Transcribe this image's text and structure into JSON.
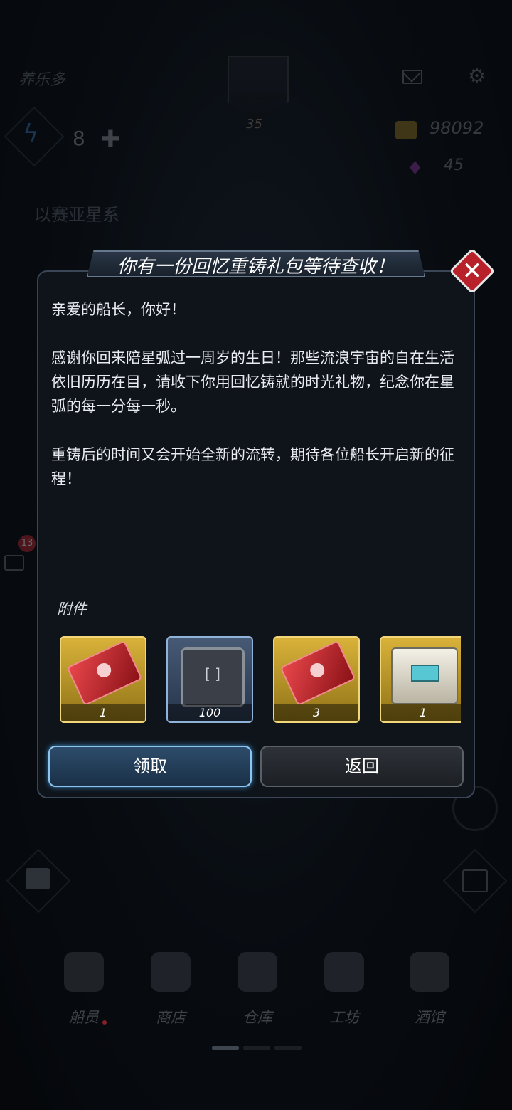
{
  "hud": {
    "player_name": "养乐多",
    "level": "35",
    "energy": "8",
    "gold": "98092",
    "gems": "45",
    "system_name": "以赛亚星系",
    "chat_badge": "13"
  },
  "dialog": {
    "title": "你有一份回忆重铸礼包等待查收！",
    "greeting": "亲爱的船长，你好！",
    "paragraph1": "感谢你回来陪星弧过一周岁的生日！那些流浪宇宙的自在生活依旧历历在目，请收下你用回忆铸就的时光礼物，纪念你在星弧的每一分每一秒。",
    "paragraph2": "重铸后的时间又会开始全新的流转，期待各位船长开启新的征程！",
    "attachments_label": "附件",
    "items": [
      {
        "icon": "red-ticket-icon",
        "quantity": "1",
        "frame": "gold"
      },
      {
        "icon": "chip-module-icon",
        "quantity": "100",
        "frame": "blue"
      },
      {
        "icon": "red-ticket-icon",
        "quantity": "3",
        "frame": "gold"
      },
      {
        "icon": "supply-box-icon",
        "quantity": "1",
        "frame": "gold"
      }
    ],
    "claim_label": "领取",
    "back_label": "返回"
  },
  "nav": [
    {
      "label": "船员",
      "icon": "crew-icon"
    },
    {
      "label": "商店",
      "icon": "shop-icon"
    },
    {
      "label": "仓库",
      "icon": "warehouse-icon"
    },
    {
      "label": "工坊",
      "icon": "workshop-icon"
    },
    {
      "label": "酒馆",
      "icon": "tavern-icon"
    }
  ],
  "colors": {
    "accent": "#8cc6f0",
    "gold_frame": "#d9b23a",
    "close_red": "#b8212a"
  }
}
